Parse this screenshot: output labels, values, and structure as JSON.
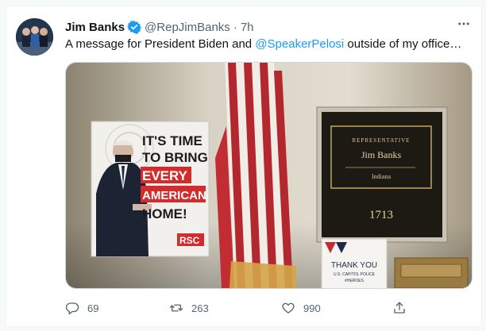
{
  "tweet": {
    "author_name": "Jim Banks",
    "handle": "@RepJimBanks",
    "separator": "·",
    "time": "7h",
    "text_before": "A message for President Biden and ",
    "mention": "@SpeakerPelosi",
    "text_after": " outside of my office…"
  },
  "poster": {
    "line1": "IT'S TIME",
    "line2": "TO BRING",
    "line3": "EVERY",
    "line4": "AMERICAN",
    "line5": "HOME!",
    "logo": "RSC"
  },
  "plaque": {
    "title": "REPRESENTATIVE",
    "name": "Jim Banks",
    "state": "Indiana",
    "room": "1713"
  },
  "thankyou": {
    "line1": "THANK YOU",
    "line2": "U.S. CAPITOL POLICE",
    "line3": "#HEROES"
  },
  "actions": {
    "replies": "69",
    "retweets": "263",
    "likes": "990"
  },
  "colors": {
    "accent": "#1d9bf0",
    "muted": "#536471",
    "text": "#0f1419"
  }
}
